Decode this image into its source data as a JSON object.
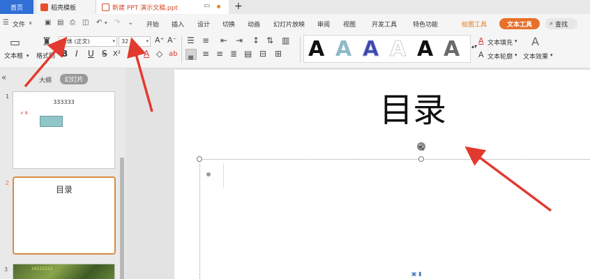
{
  "tabs": {
    "home": "首页",
    "template": "稻壳模板",
    "document": "新建 PPT 演示文稿.ppt",
    "new_tab": "+"
  },
  "menu": {
    "file": "文件",
    "file_caret": "∨",
    "items": [
      "开始",
      "插入",
      "设计",
      "切换",
      "动画",
      "幻灯片放映",
      "审阅",
      "视图",
      "开发工具",
      "特色功能"
    ],
    "draw_tools": "绘图工具",
    "text_tools": "文本工具",
    "search": "查找"
  },
  "ribbon": {
    "textbox_label": "文本框",
    "format_brush_label": "格式刷",
    "font_name": "宋体 (正文)",
    "font_size": "32",
    "format_buttons": [
      "B",
      "I",
      "U",
      "S",
      "X²",
      "X₂"
    ],
    "text_fill": "文本填充",
    "text_outline": "文本轮廓",
    "text_effect": "文本效果"
  },
  "gallery": {
    "glyph": "A",
    "colors": [
      "#111111",
      "#8fb9c8",
      "#3b46a8",
      "#e0e0e0",
      "#111111",
      "#6a6a6a"
    ]
  },
  "panel": {
    "outline_label": "大纲",
    "slides_label": "幻灯片",
    "collapse": "«"
  },
  "thumbnails": [
    {
      "number": "1",
      "title": "333333",
      "mark": "✔ 8"
    },
    {
      "number": "2",
      "title": "目录"
    },
    {
      "number": "3",
      "caption": "24222222"
    }
  ],
  "slide": {
    "title": "目录"
  },
  "colors": {
    "accent": "#e8702a",
    "tab_active": "#2f6fd6",
    "arrow": "#e23a2f"
  }
}
